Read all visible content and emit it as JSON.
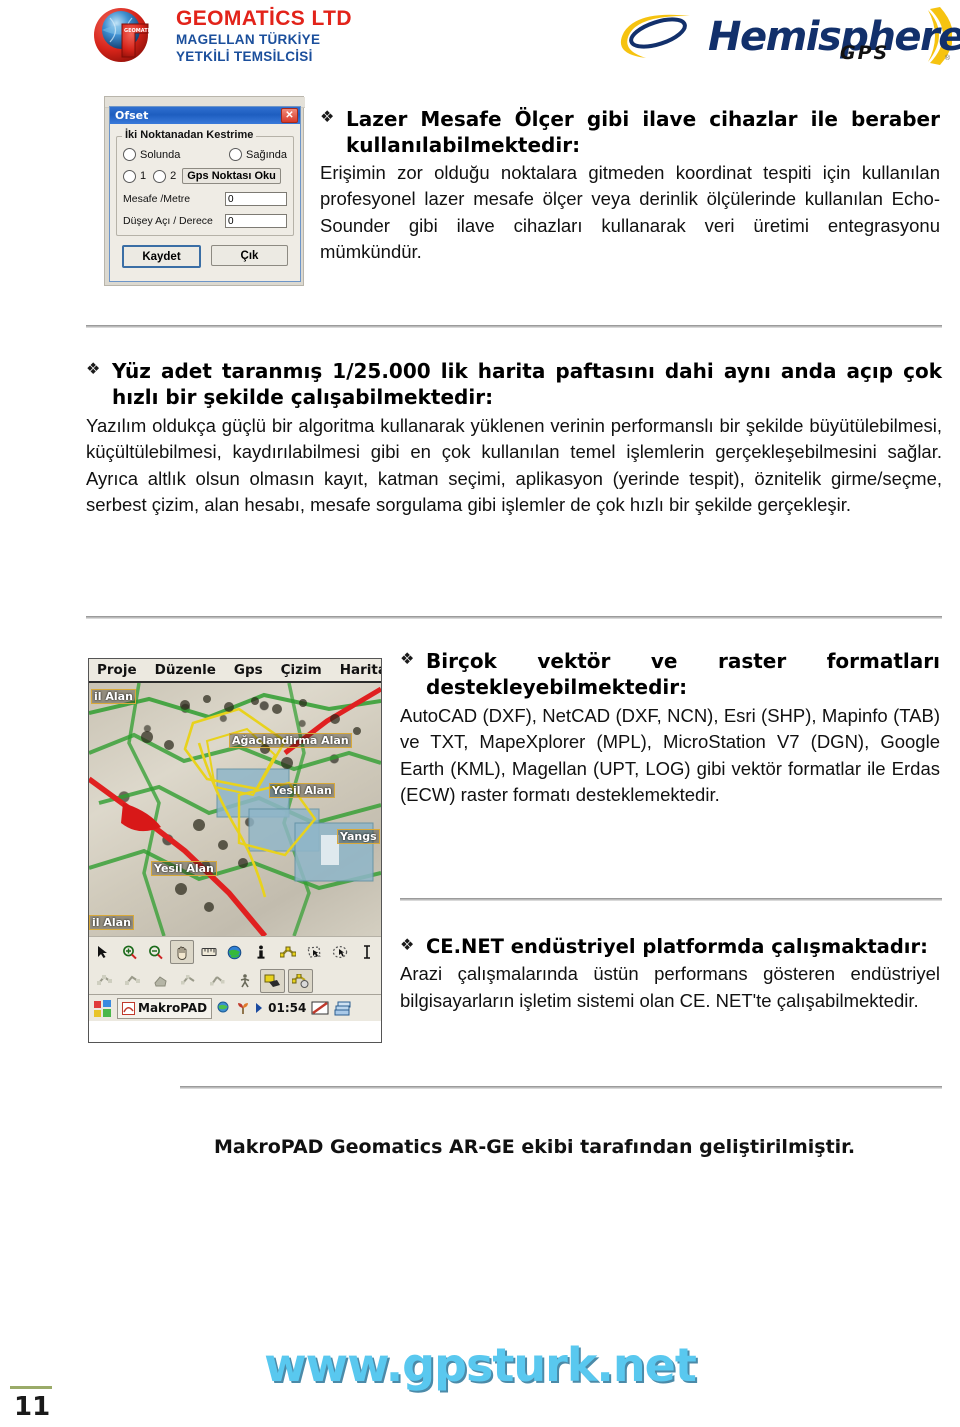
{
  "header": {
    "geomatics": {
      "line1": "GEOMATİCS LTD",
      "line2": "MAGELLAN TÜRKİYE",
      "line3": "YETKİLİ TEMSİLCİSİ",
      "red": "#e2231a",
      "blue": "#1b4f9c"
    },
    "hemisphere": {
      "word": "Hemisphere",
      "sub": "GPS",
      "registered": "®",
      "navy": "#12306b",
      "gold": "#f6c310"
    }
  },
  "ofset_dialog": {
    "title": "Ofset",
    "close_label": "✕",
    "group_legend": "İki Noktanadan Kestrime",
    "radio_left": "Solunda",
    "radio_right": "Sağında",
    "radio_one": "1",
    "radio_two": "2",
    "gps_button": "Gps Noktası Oku",
    "field1_label": "Mesafe /Metre",
    "field1_value": "0",
    "field2_label": "Düşey Açı / Derece",
    "field2_value": "0",
    "save_button": "Kaydet",
    "exit_button": "Çık"
  },
  "sections": [
    {
      "bullet": "❖",
      "heading": "Lazer Mesafe Ölçer gibi ilave cihazlar ile beraber kullanılabilmektedir:",
      "body": "Erişimin zor olduğu noktalara gitmeden koordinat tespiti için kullanılan profesyonel lazer mesafe ölçer veya derinlik ölçülerinde kullanılan Echo-Sounder gibi ilave cihazları kullanarak veri üretimi entegrasyonu mümkündür."
    },
    {
      "bullet": "❖",
      "heading": "Yüz adet taranmış 1/25.000 lik harita paftasını dahi aynı anda açıp çok hızlı bir şekilde çalışabilmektedir:",
      "body": "Yazılım oldukça güçlü bir algoritma kullanarak yüklenen verinin performanslı bir şekilde büyütülebilmesi, küçültülebilmesi, kaydırılabilmesi gibi en çok kullanılan temel işlemlerin gerçekleşebilmesini sağlar. Ayrıca altlık olsun olmasın kayıt, katman seçimi, aplikasyon (yerinde tespit), öznitelik girme/seçme, serbest çizim, alan hesabı, mesafe sorgulama gibi işlemler de çok hızlı bir şekilde gerçekleşir."
    },
    {
      "bullet": "❖",
      "heading": "Birçok vektör ve raster formatları destekleyebilmektedir:",
      "body": "AutoCAD (DXF), NetCAD (DXF, NCN), Esri (SHP), Mapinfo (TAB) ve TXT, MapeXplorer (MPL), MicroStation V7 (DGN), Google Earth (KML), Magellan (UPT, LOG) gibi vektör formatlar ile Erdas (ECW) raster formatı desteklemektedir."
    },
    {
      "bullet": "❖",
      "heading": "CE.NET endüstriyel platformda çalışmaktadır:",
      "body": "Arazi çalışmalarında üstün performans gösteren endüstriyel bilgisayarların işletim sistemi olan CE. NET'te çalışabilmektedir."
    }
  ],
  "footer_note": "MakroPAD Geomatics AR-GE ekibi tarafından geliştirilmiştir.",
  "gis_screenshot": {
    "menu": [
      "Proje",
      "Düzenle",
      "Gps",
      "Çizim",
      "Harita"
    ],
    "map_labels": [
      "il Alan",
      "Ağaclandirma  Alan",
      "Yesil Alan",
      "Yesil Alan",
      "Yangs",
      "il Alan"
    ],
    "toolbar_icons": [
      "arrow-select-icon",
      "zoom-in-icon",
      "zoom-out-icon",
      "pan-hand-icon",
      "measure-icon",
      "globe-icon",
      "info-icon",
      "node-edit-icon",
      "polygon-select-icon",
      "lasso-select-icon",
      "text-icon"
    ],
    "toolbar2_icons": [
      "line-node-icon",
      "line-add-icon",
      "polygon-fill-icon",
      "node-move-icon",
      "node-split-icon",
      "walk-icon",
      "layer-tag-icon",
      "gps-point-icon"
    ],
    "taskbar": {
      "start": "start-icon",
      "app_label": "MakroPAD",
      "tray_icons": [
        "globe-tray-icon",
        "plant-tray-icon",
        "arrow-tray-icon"
      ],
      "clock": "01:54",
      "right_icons": [
        "keyboard-icon",
        "windows-stack-icon"
      ]
    }
  },
  "website_url": "www.gpsturk.net",
  "page_number": "11",
  "colors": {
    "rule": "#9b9b9b",
    "url_text": "#59c8ef",
    "url_shadow": "#4b8aa8",
    "page_rule": "#9aab68"
  }
}
